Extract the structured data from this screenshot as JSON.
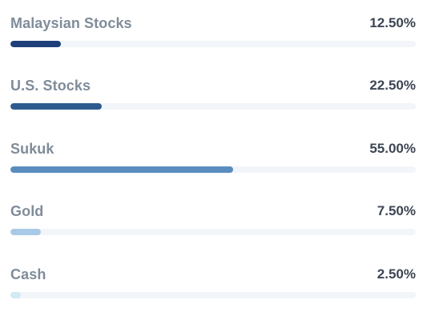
{
  "allocations": [
    {
      "name": "Malaysian Stocks",
      "percent_label": "12.50%",
      "percent": 12.5,
      "color": "#1f3f7a"
    },
    {
      "name": "U.S. Stocks",
      "percent_label": "22.50%",
      "percent": 22.5,
      "color": "#2e5b8e"
    },
    {
      "name": "Sukuk",
      "percent_label": "55.00%",
      "percent": 55.0,
      "color": "#5a8cbf"
    },
    {
      "name": "Gold",
      "percent_label": "7.50%",
      "percent": 7.5,
      "color": "#a9cae6"
    },
    {
      "name": "Cash",
      "percent_label": "2.50%",
      "percent": 2.5,
      "color": "#d3e9f4"
    }
  ],
  "colors": {
    "label": "#7f8c99",
    "value": "#3d4653",
    "track": "#f2f5f9"
  }
}
